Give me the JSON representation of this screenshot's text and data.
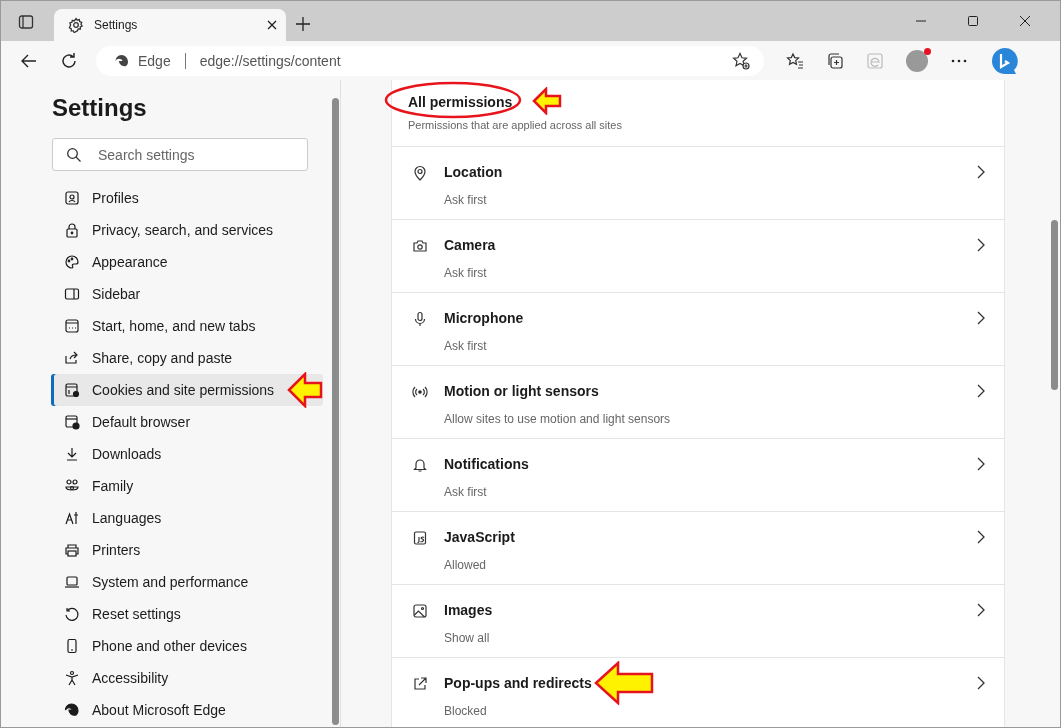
{
  "tab": {
    "title": "Settings",
    "selected": true
  },
  "address_bar": {
    "site_label": "Edge",
    "url": "edge://settings/content"
  },
  "sidebar": {
    "title": "Settings",
    "search": {
      "placeholder": "Search settings"
    },
    "items": [
      {
        "label": "Profiles",
        "selected": false
      },
      {
        "label": "Privacy, search, and services",
        "selected": false
      },
      {
        "label": "Appearance",
        "selected": false
      },
      {
        "label": "Sidebar",
        "selected": false
      },
      {
        "label": "Start, home, and new tabs",
        "selected": false
      },
      {
        "label": "Share, copy and paste",
        "selected": false
      },
      {
        "label": "Cookies and site permissions",
        "selected": true
      },
      {
        "label": "Default browser",
        "selected": false
      },
      {
        "label": "Downloads",
        "selected": false
      },
      {
        "label": "Family",
        "selected": false
      },
      {
        "label": "Languages",
        "selected": false
      },
      {
        "label": "Printers",
        "selected": false
      },
      {
        "label": "System and performance",
        "selected": false
      },
      {
        "label": "Reset settings",
        "selected": false
      },
      {
        "label": "Phone and other devices",
        "selected": false
      },
      {
        "label": "Accessibility",
        "selected": false
      },
      {
        "label": "About Microsoft Edge",
        "selected": false
      }
    ]
  },
  "permissions": {
    "title": "All permissions",
    "subtitle": "Permissions that are applied across all sites",
    "items": [
      {
        "name": "Location",
        "value": "Ask first"
      },
      {
        "name": "Camera",
        "value": "Ask first"
      },
      {
        "name": "Microphone",
        "value": "Ask first"
      },
      {
        "name": "Motion or light sensors",
        "value": "Allow sites to use motion and light sensors"
      },
      {
        "name": "Notifications",
        "value": "Ask first"
      },
      {
        "name": "JavaScript",
        "value": "Allowed"
      },
      {
        "name": "Images",
        "value": "Show all"
      },
      {
        "name": "Pop-ups and redirects",
        "value": "Blocked"
      }
    ]
  }
}
